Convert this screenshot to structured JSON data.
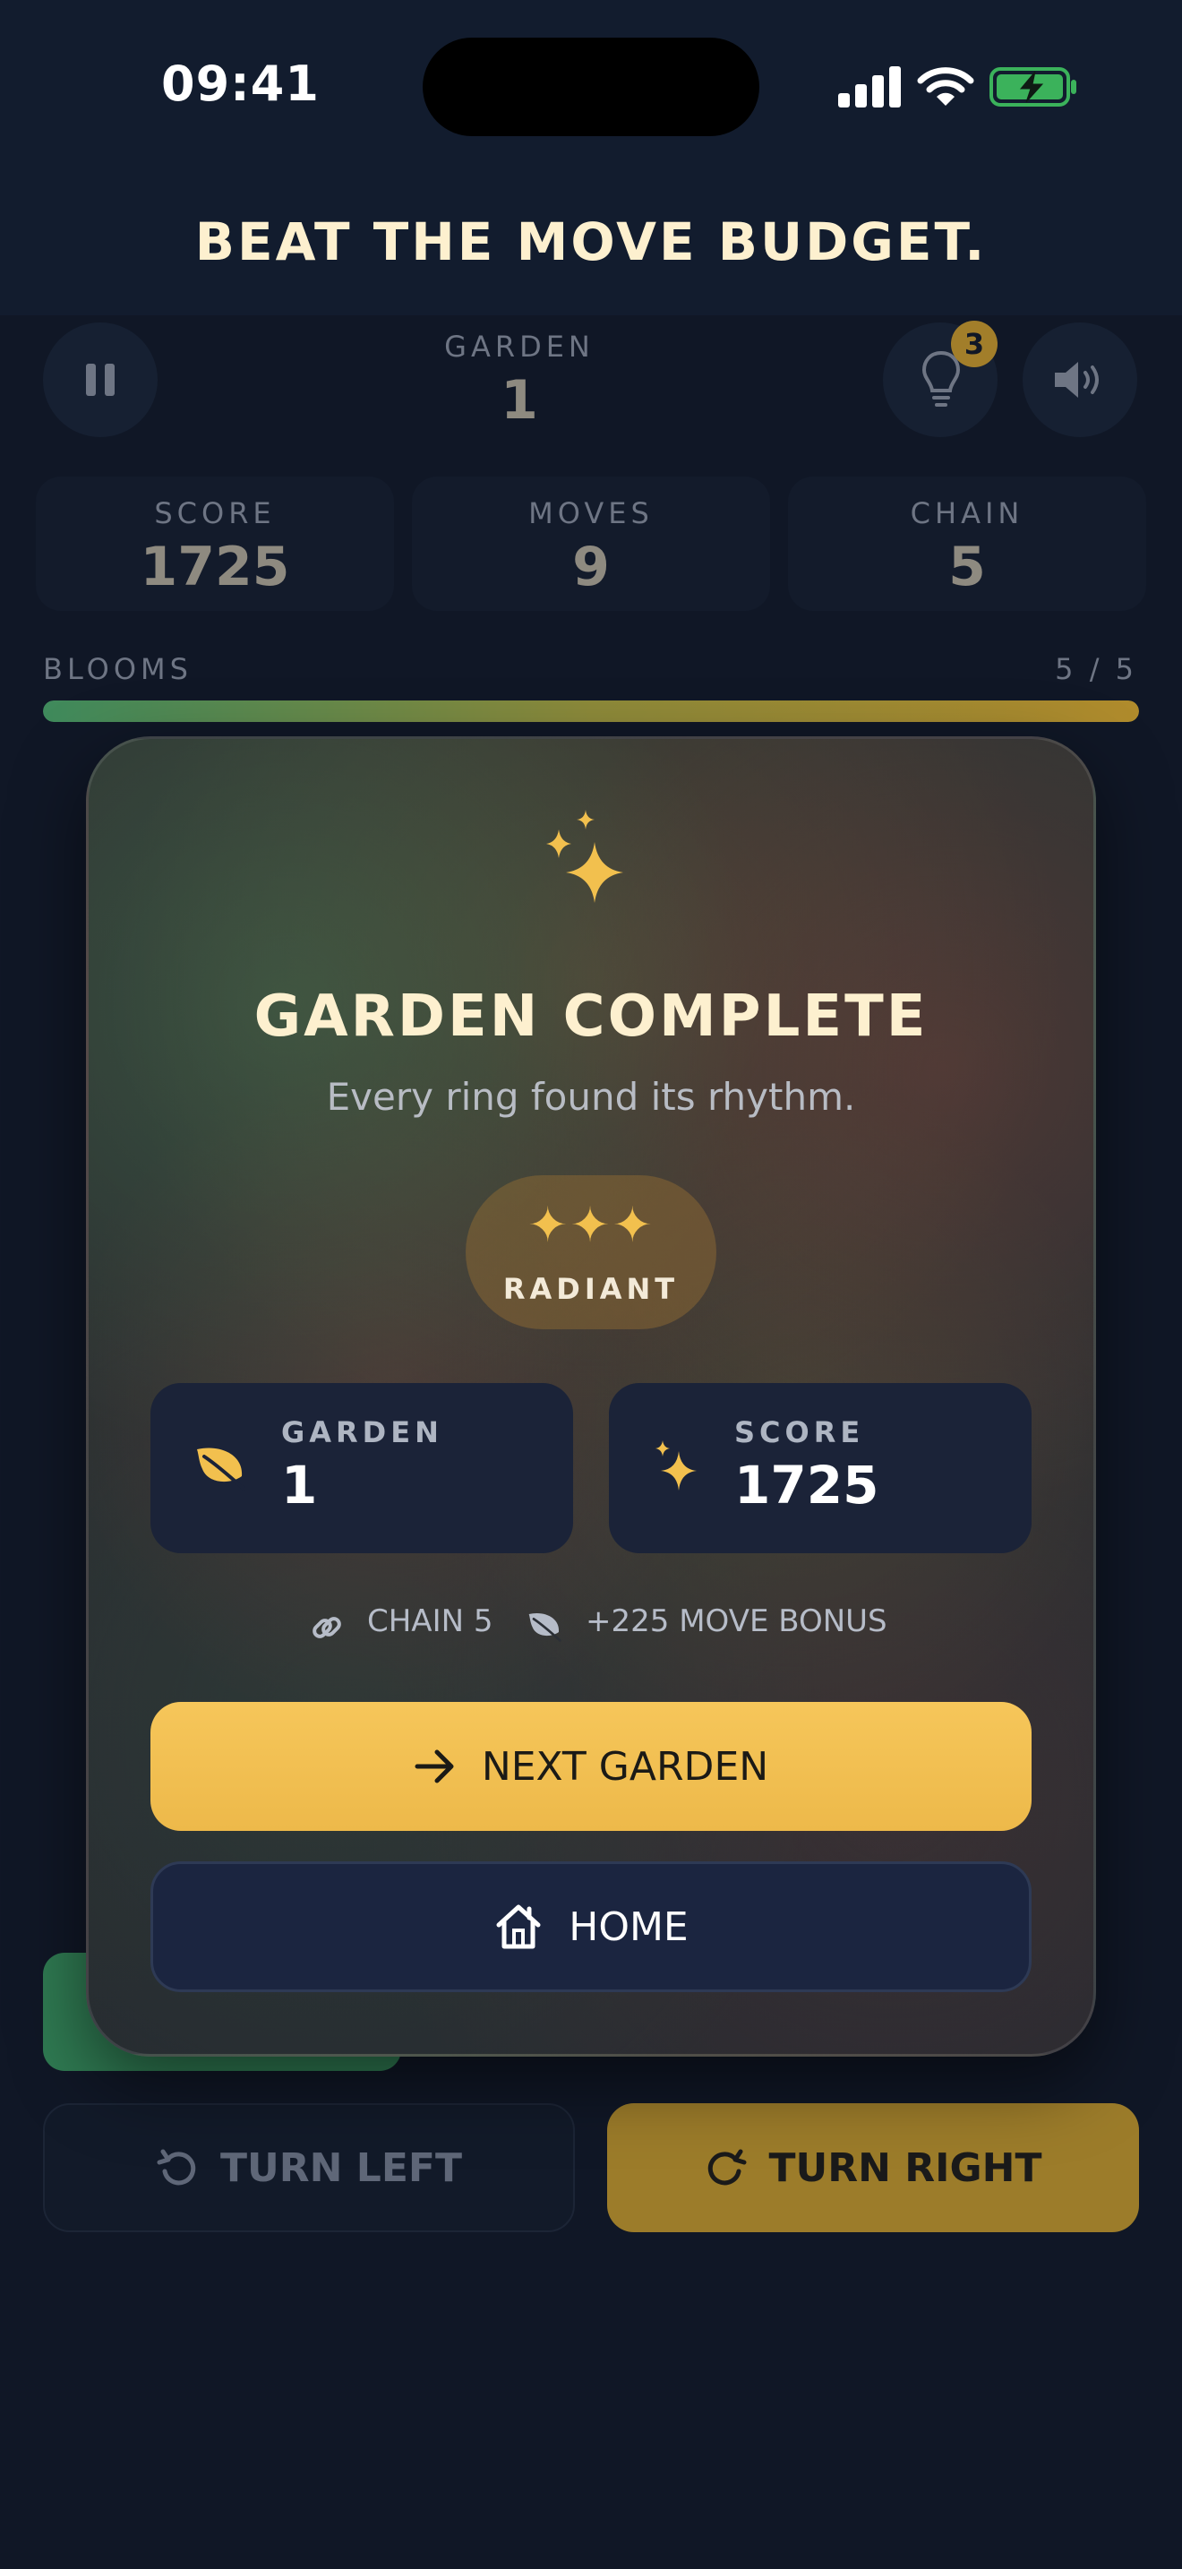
{
  "status_bar": {
    "time": "09:41",
    "icons": [
      "cellular-signal-icon",
      "wifi-icon",
      "battery-charging-icon"
    ]
  },
  "banner": {
    "text": "BEAT THE MOVE BUDGET."
  },
  "hud": {
    "garden_label": "GARDEN",
    "garden_value": "1",
    "hint_count": "3",
    "stats": [
      {
        "label": "SCORE",
        "value": "1725"
      },
      {
        "label": "MOVES",
        "value": "9"
      },
      {
        "label": "CHAIN",
        "value": "5"
      }
    ],
    "blooms_label": "BLOOMS",
    "blooms_count": "5 / 5",
    "blooms_progress": 1.0
  },
  "controls": {
    "turn_left": "TURN LEFT",
    "turn_right": "TURN RIGHT"
  },
  "modal": {
    "title": "GARDEN COMPLETE",
    "subtitle": "Every ring found its rhythm.",
    "stars": "✦✦✦",
    "rating": "RADIANT",
    "cards": [
      {
        "label": "GARDEN",
        "value": "1",
        "icon": "leaf-icon"
      },
      {
        "label": "SCORE",
        "value": "1725",
        "icon": "sparkle-icon"
      }
    ],
    "chain_text": "CHAIN 5",
    "bonus_text": "+225 MOVE BONUS",
    "next_button": "NEXT GARDEN",
    "home_button": "HOME"
  },
  "colors": {
    "accent_gold": "#F2C04E",
    "background": "#101726",
    "card": "#1B2338",
    "text_cream": "#FDF0CF"
  }
}
